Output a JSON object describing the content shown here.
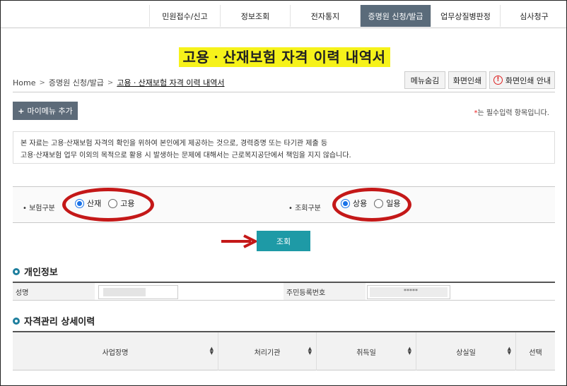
{
  "nav": {
    "tabs": [
      {
        "label": "민원접수/신고"
      },
      {
        "label": "정보조회"
      },
      {
        "label": "전자통지"
      },
      {
        "label": "증명원 신청/발급"
      },
      {
        "label": "업무상질병판정"
      },
      {
        "label": "심사청구"
      }
    ]
  },
  "page": {
    "title": "고용ㆍ산재보험 자격 이력 내역서"
  },
  "breadcrumb": {
    "home": "Home",
    "sep": ">",
    "level1": "증명원 신청/발급",
    "current": "고용ㆍ산재보험 자격 이력 내역서"
  },
  "toolbar": {
    "hide_menu": "메뉴숨김",
    "print": "화면인쇄",
    "print_guide": "화면인쇄 안내",
    "warn_glyph": "!"
  },
  "mymenu": {
    "plus": "+",
    "label": "마이메뉴 추가"
  },
  "required": {
    "star": "*",
    "text": "는 필수입력 항목입니다."
  },
  "notice": {
    "line1": "본 자료는 고용·산재보험 자격의 확인을 위하여 본인에게 제공하는 것으로, 경력증명 또는 타기관 제출 등",
    "line2": "고용·산재보험 업무 이외의 목적으로 활용 시 발생하는 문제에 대해서는 근로복지공단에서 책임을 지지 않습니다."
  },
  "search": {
    "insurance_label": "• 보험구분",
    "insurance_options": [
      {
        "label": "산재",
        "selected": true
      },
      {
        "label": "고용",
        "selected": false
      }
    ],
    "query_label": "• 조회구분",
    "query_options": [
      {
        "label": "상용",
        "selected": true
      },
      {
        "label": "일용",
        "selected": false
      }
    ],
    "button": "조회"
  },
  "personal": {
    "title": "개인정보",
    "name_label": "성명",
    "rrn_label": "주민등록번호",
    "rrn_value": "*****"
  },
  "history": {
    "title": "자격관리 상세이력",
    "columns": [
      {
        "label": "사업장명",
        "sortable": true
      },
      {
        "label": "처리기관",
        "sortable": true
      },
      {
        "label": "취득일",
        "sortable": true
      },
      {
        "label": "상실일",
        "sortable": true
      },
      {
        "label": "선택",
        "sortable": false
      }
    ]
  },
  "colors": {
    "accent": "#1e9aa6",
    "nav_active": "#5a6b7a",
    "highlight": "#f6f21a",
    "annotation": "#c41818"
  }
}
